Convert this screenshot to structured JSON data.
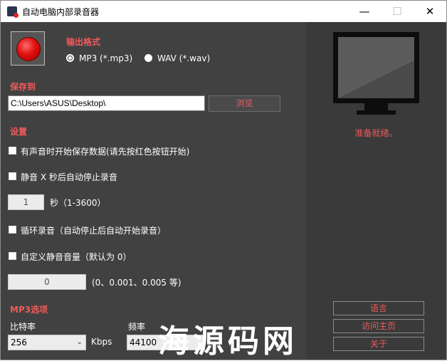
{
  "window": {
    "title": "自动电脑内部录音器",
    "minimize_glyph": "—",
    "maximize_glyph": "☐",
    "close_glyph": "✕"
  },
  "output_format": {
    "heading": "输出格式",
    "options": [
      {
        "label": "MP3 (*.mp3)",
        "selected": true
      },
      {
        "label": "WAV (*.wav)",
        "selected": false
      }
    ]
  },
  "save_to": {
    "heading": "保存到",
    "path": "C:\\Users\\ASUS\\Desktop\\",
    "browse_label": "浏览"
  },
  "settings": {
    "heading": "设置",
    "start_on_sound_label": "有声音时开始保存数据(请先按红色按钮开始)",
    "start_on_sound_checked": false,
    "auto_stop_label": "静音 X 秒后自动停止录音",
    "auto_stop_checked": false,
    "seconds_value": "1",
    "seconds_unit_label": "秒（1-3600）",
    "loop_label": "循环录音（自动停止后自动开始录音）",
    "loop_checked": false,
    "custom_silence_label": "自定义静音音量（默认为 0）",
    "custom_silence_checked": false,
    "silence_value": "0",
    "silence_hint_label": "(0、0.001、0.005 等)"
  },
  "mp3_options": {
    "heading": "MP3选项",
    "bitrate_label": "比特率",
    "bitrate_value": "256",
    "bitrate_unit": "Kbps",
    "frequency_label": "频率",
    "frequency_value": "44100"
  },
  "side_panel": {
    "status": "准备就绪。",
    "language_label": "语言",
    "homepage_label": "访问主页",
    "about_label": "关于"
  },
  "watermark": "海源码网",
  "colors": {
    "accent_red": "#f05a5a",
    "panel_bg": "#414141",
    "side_bg": "#3a3a3a"
  },
  "icons": {
    "record": "record-button-red-circle",
    "monitor": "monitor-icon",
    "app": "app-icon"
  }
}
